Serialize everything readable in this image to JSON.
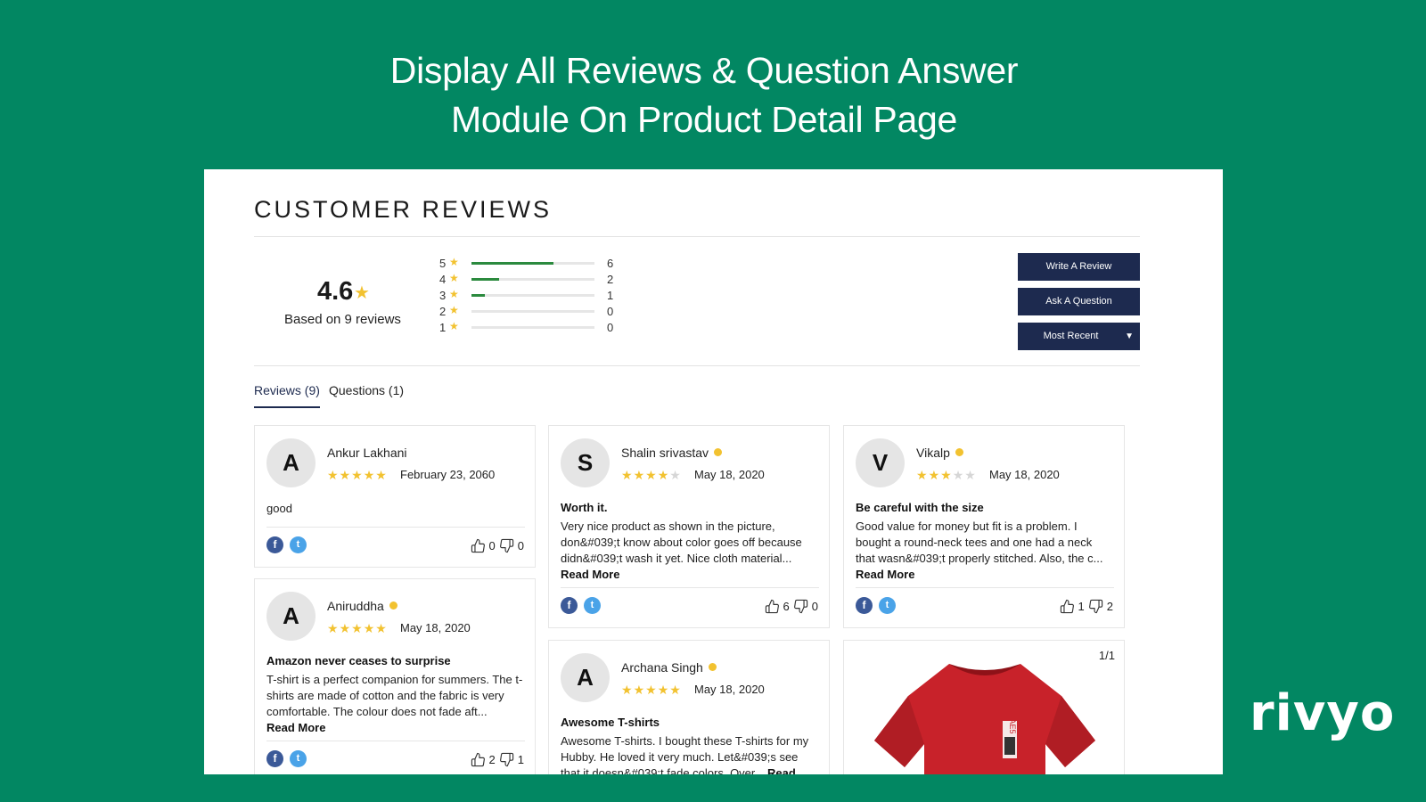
{
  "headline": {
    "line1": "Display All Reviews & Question Answer",
    "line2": "Module On Product Detail Page"
  },
  "brand": "rivyo",
  "section_title": "CUSTOMER REVIEWS",
  "summary": {
    "average": "4.6",
    "based_on": "Based on 9 reviews"
  },
  "distribution": [
    {
      "stars": "5",
      "count": "6",
      "fraction": 0.667
    },
    {
      "stars": "4",
      "count": "2",
      "fraction": 0.222
    },
    {
      "stars": "3",
      "count": "1",
      "fraction": 0.111
    },
    {
      "stars": "2",
      "count": "0",
      "fraction": 0
    },
    {
      "stars": "1",
      "count": "0",
      "fraction": 0
    }
  ],
  "actions": {
    "write_review": "Write A Review",
    "ask_question": "Ask A Question",
    "sort": "Most Recent"
  },
  "tabs": [
    {
      "label": "Reviews (9)",
      "active": true
    },
    {
      "label": "Questions (1)",
      "active": false
    }
  ],
  "reviews": [
    {
      "initial": "A",
      "name": "Ankur Lakhani",
      "verified": false,
      "rating": 5,
      "date": "February 23, 2060",
      "title": "",
      "body": "good",
      "read_more": "",
      "likes": "0",
      "dislikes": "0"
    },
    {
      "initial": "S",
      "name": "Shalin srivastav",
      "verified": true,
      "rating": 4,
      "date": "May 18, 2020",
      "title": "Worth it.",
      "body": "Very nice product as shown in the picture, don&#039;t know about color goes off because didn&#039;t wash it yet. Nice cloth material...",
      "read_more": "Read More",
      "likes": "6",
      "dislikes": "0"
    },
    {
      "initial": "V",
      "name": "Vikalp",
      "verified": true,
      "rating": 3,
      "date": "May 18, 2020",
      "title": "Be careful with the size",
      "body": "Good value for money but fit is a problem. I bought a round-neck tees and one had a neck that wasn&#039;t properly stitched. Also, the c...",
      "read_more": "Read More",
      "likes": "1",
      "dislikes": "2"
    },
    {
      "initial": "A",
      "name": "Aniruddha",
      "verified": true,
      "rating": 5,
      "date": "May 18, 2020",
      "title": "Amazon never ceases to surprise",
      "body": "T-shirt is a perfect companion for summers. The t-shirts are made of cotton and the fabric is very comfortable. The colour does not fade aft...",
      "read_more": "Read More",
      "likes": "2",
      "dislikes": "1"
    },
    {
      "initial": "A",
      "name": "Archana Singh",
      "verified": true,
      "rating": 5,
      "date": "May 18, 2020",
      "title": "Awesome T-shirts",
      "body": "Awesome T-shirts. I bought these T-shirts for my Hubby. He loved it very much. Let&#039;s see that it doesn&#039;t fade colors. Over...",
      "read_more": "Read",
      "likes": "",
      "dislikes": ""
    }
  ],
  "photo_card": {
    "pager": "1/1",
    "tshirt_print": "AE5"
  },
  "colors": {
    "background": "#028762",
    "button": "#1d2a4f",
    "star": "#f2c230",
    "bar": "#2b8a3e"
  }
}
